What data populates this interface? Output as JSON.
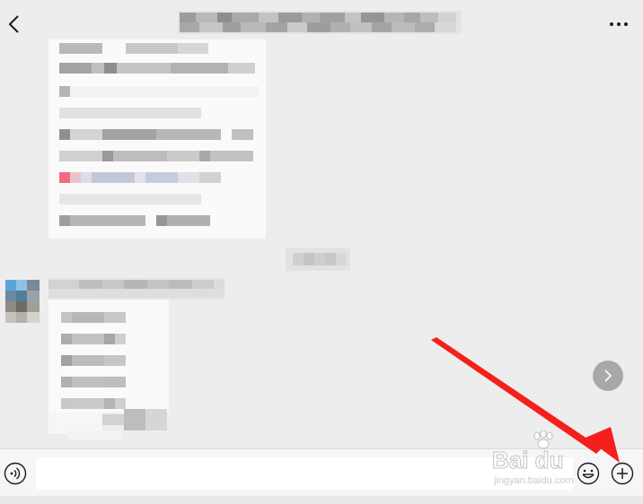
{
  "header": {
    "title": "",
    "back_icon": "chevron-left-icon",
    "more_icon": "more-dots-icon"
  },
  "chat": {
    "received_message_note": "Pixelated (mosaic-blurred) message bubbles; content is not readable",
    "timestamp": "",
    "sender_name": "",
    "scroll_button_icon": "chevron-right-icon"
  },
  "input_bar": {
    "voice_icon": "voice-input-icon",
    "text_value": "",
    "placeholder": "",
    "emoji_icon": "emoji-icon",
    "plus_icon": "plus-circle-icon"
  },
  "annotation": {
    "arrow_color": "#f5201b",
    "arrow_target": "plus-button"
  },
  "watermark": {
    "brand": "Bai du",
    "subtitle": "jingyan.baidu.com"
  },
  "colors": {
    "background": "#ededed",
    "bubble": "#ffffff",
    "input_bar": "#f6f6f6",
    "accent_red": "#f5201b"
  }
}
